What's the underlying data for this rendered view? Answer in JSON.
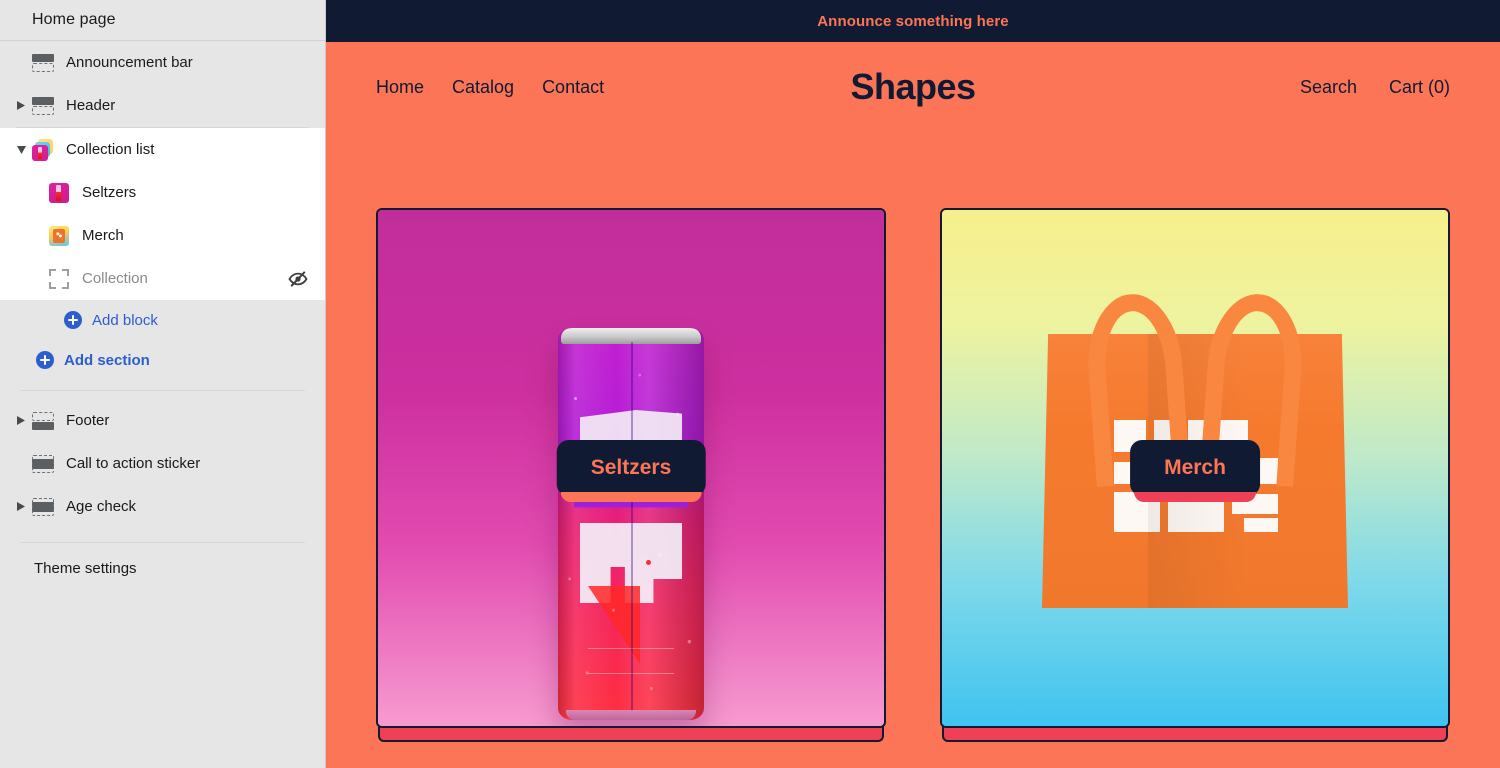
{
  "sidebar": {
    "header_title": "Home page",
    "sections": [
      {
        "label": "Announcement bar",
        "icon": "section-icon",
        "expandable": false
      },
      {
        "label": "Header",
        "icon": "section-icon",
        "expandable": true
      }
    ],
    "collection_list": {
      "label": "Collection list",
      "icon": "collection-stack-icon",
      "blocks": [
        {
          "label": "Seltzers",
          "icon": "seltzers-thumbnail-icon",
          "hidden": false
        },
        {
          "label": "Merch",
          "icon": "merch-thumbnail-icon",
          "hidden": false
        },
        {
          "label": "Collection",
          "icon": "frame-icon",
          "hidden": true,
          "hidden_icon": "eye-off-icon"
        }
      ],
      "add_block_label": "Add block"
    },
    "add_section_label": "Add section",
    "lower_sections": [
      {
        "label": "Footer",
        "icon": "section-icon",
        "expandable": true
      },
      {
        "label": "Call to action sticker",
        "icon": "section-icon",
        "expandable": false
      },
      {
        "label": "Age check",
        "icon": "section-icon",
        "expandable": true
      }
    ],
    "theme_settings_label": "Theme settings"
  },
  "preview": {
    "announcement": {
      "text": "Announce something here"
    },
    "header": {
      "nav_left": [
        {
          "label": "Home"
        },
        {
          "label": "Catalog"
        },
        {
          "label": "Contact"
        }
      ],
      "brand": "Shapes",
      "nav_right": [
        {
          "label": "Search"
        },
        {
          "label": "Cart (0)"
        }
      ]
    },
    "cards": [
      {
        "label": "Seltzers",
        "art": "seltzer-can-photo",
        "shadow_color": "#ef4056",
        "pill_shadow": "orange"
      },
      {
        "label": "Merch",
        "art": "orange-tote-bag-photo",
        "shadow_color": "#ef4056",
        "pill_shadow": "red"
      }
    ]
  },
  "colors": {
    "brand_orange": "#fb7556",
    "navy": "#111a33",
    "accent_red": "#ef4056",
    "link_blue": "#2c5ecf",
    "sidebar_bg": "#e6e6e6"
  }
}
